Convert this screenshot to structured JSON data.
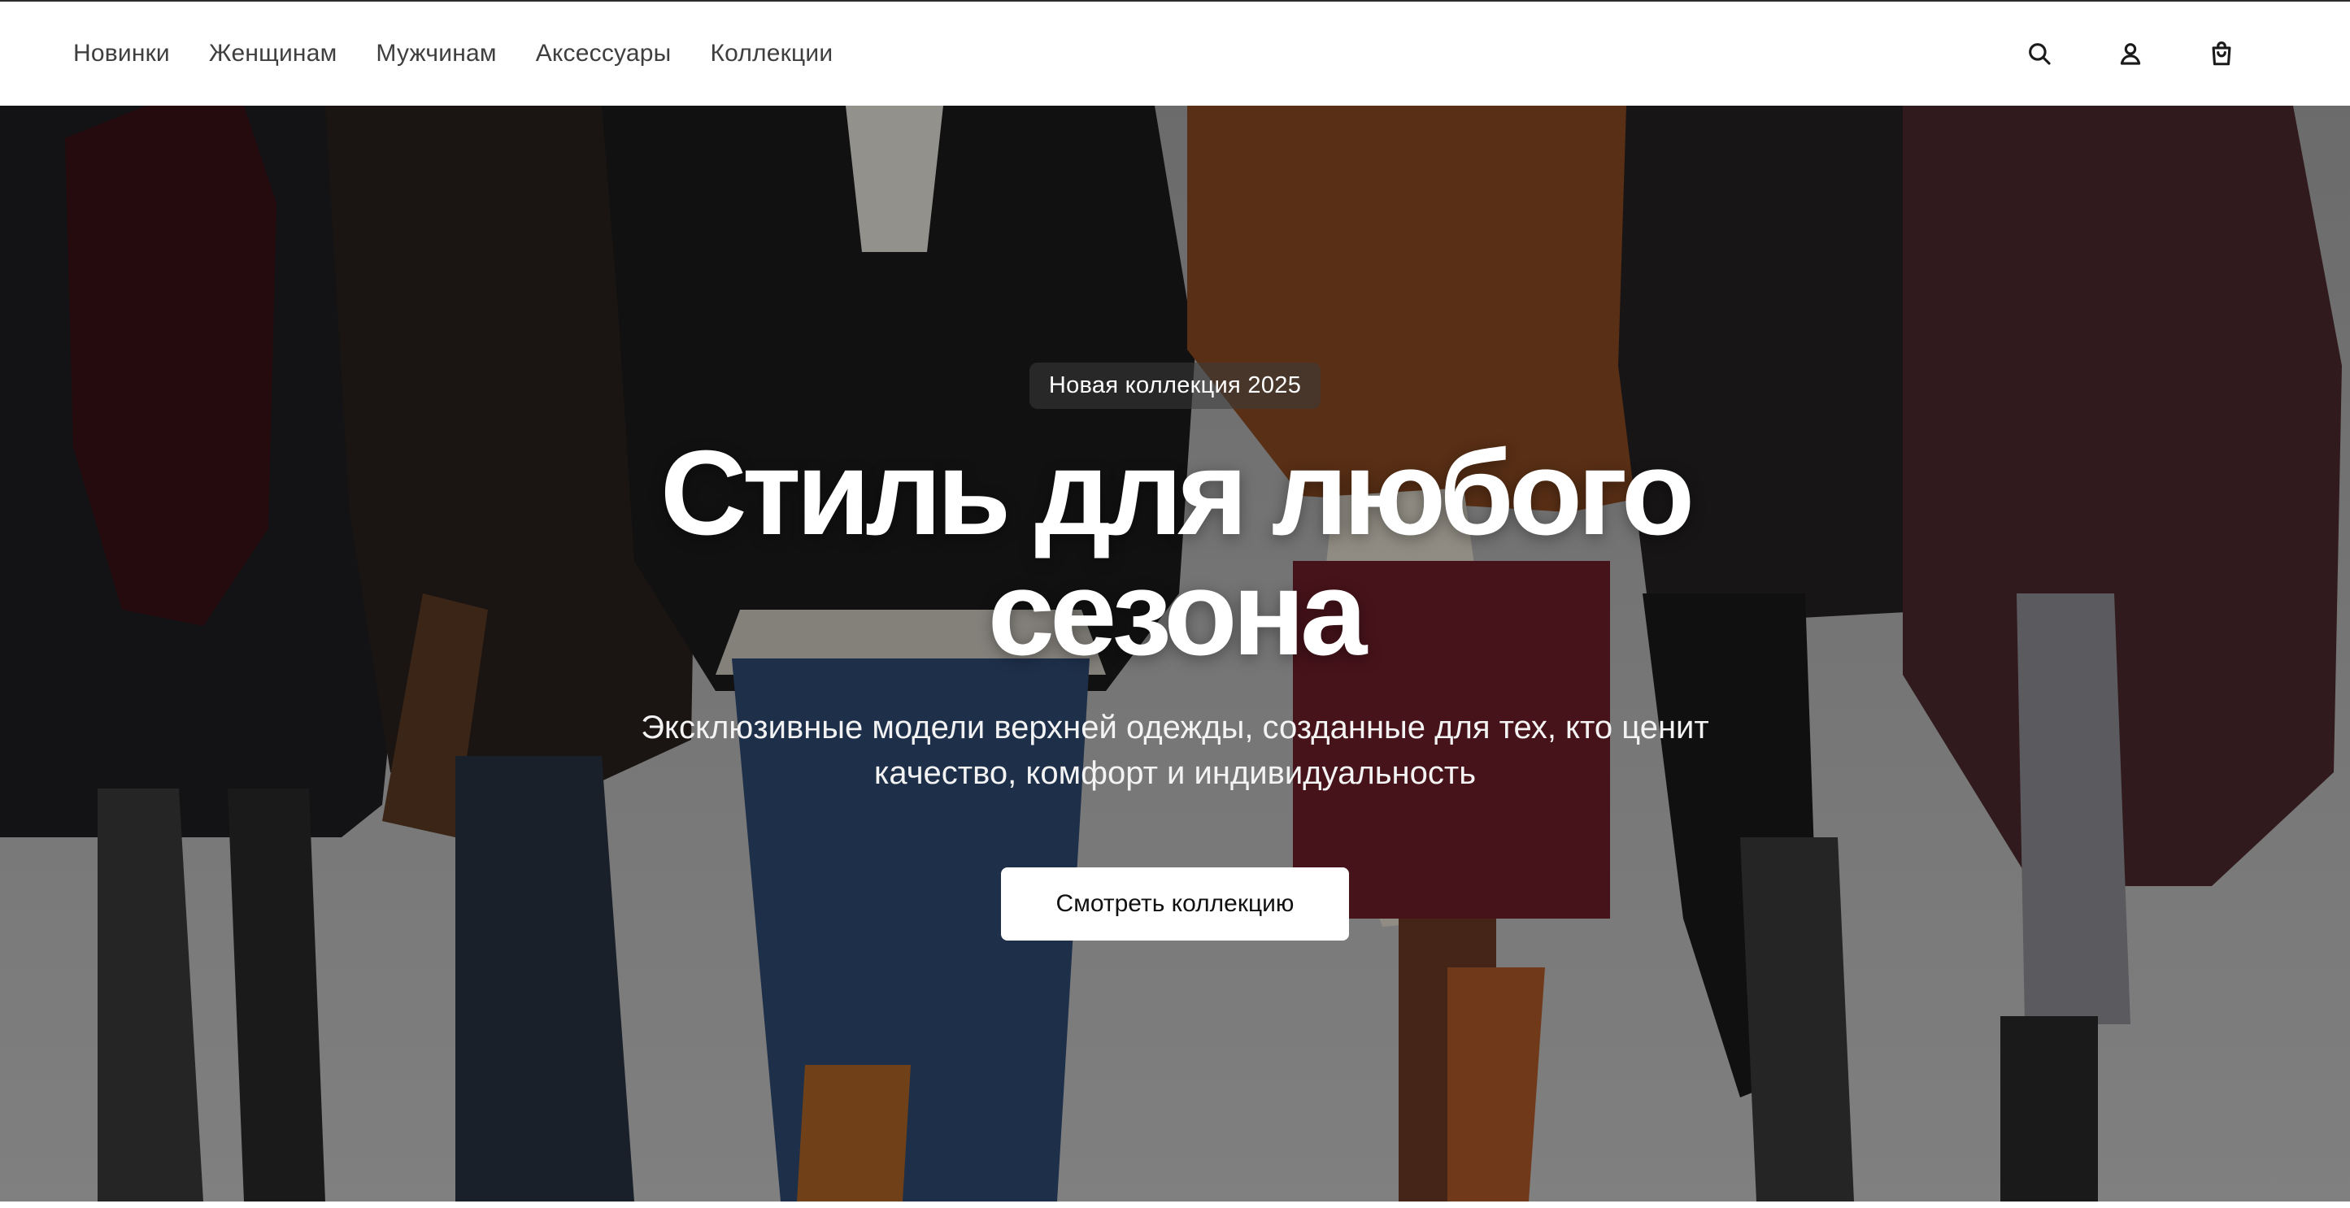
{
  "nav": {
    "items": [
      {
        "label": "Новинки"
      },
      {
        "label": "Женщинам"
      },
      {
        "label": "Мужчинам"
      },
      {
        "label": "Аксессуары"
      },
      {
        "label": "Коллекции"
      }
    ]
  },
  "header_icons": [
    "search-icon",
    "user-icon",
    "shopping-bag-icon"
  ],
  "hero": {
    "badge": "Новая коллекция 2025",
    "title": "Стиль для любого сезона",
    "subtitle": "Эксклюзивные модели верхней одежды, созданные для тех, кто ценит качество, комфорт и индивидуальность",
    "cta_label": "Смотреть коллекцию"
  },
  "colors": {
    "nav_text": "#3f3f3f",
    "overlay": "#000000",
    "cta_bg": "#ffffff",
    "cta_text": "#111111",
    "hero_text": "#ffffff"
  }
}
